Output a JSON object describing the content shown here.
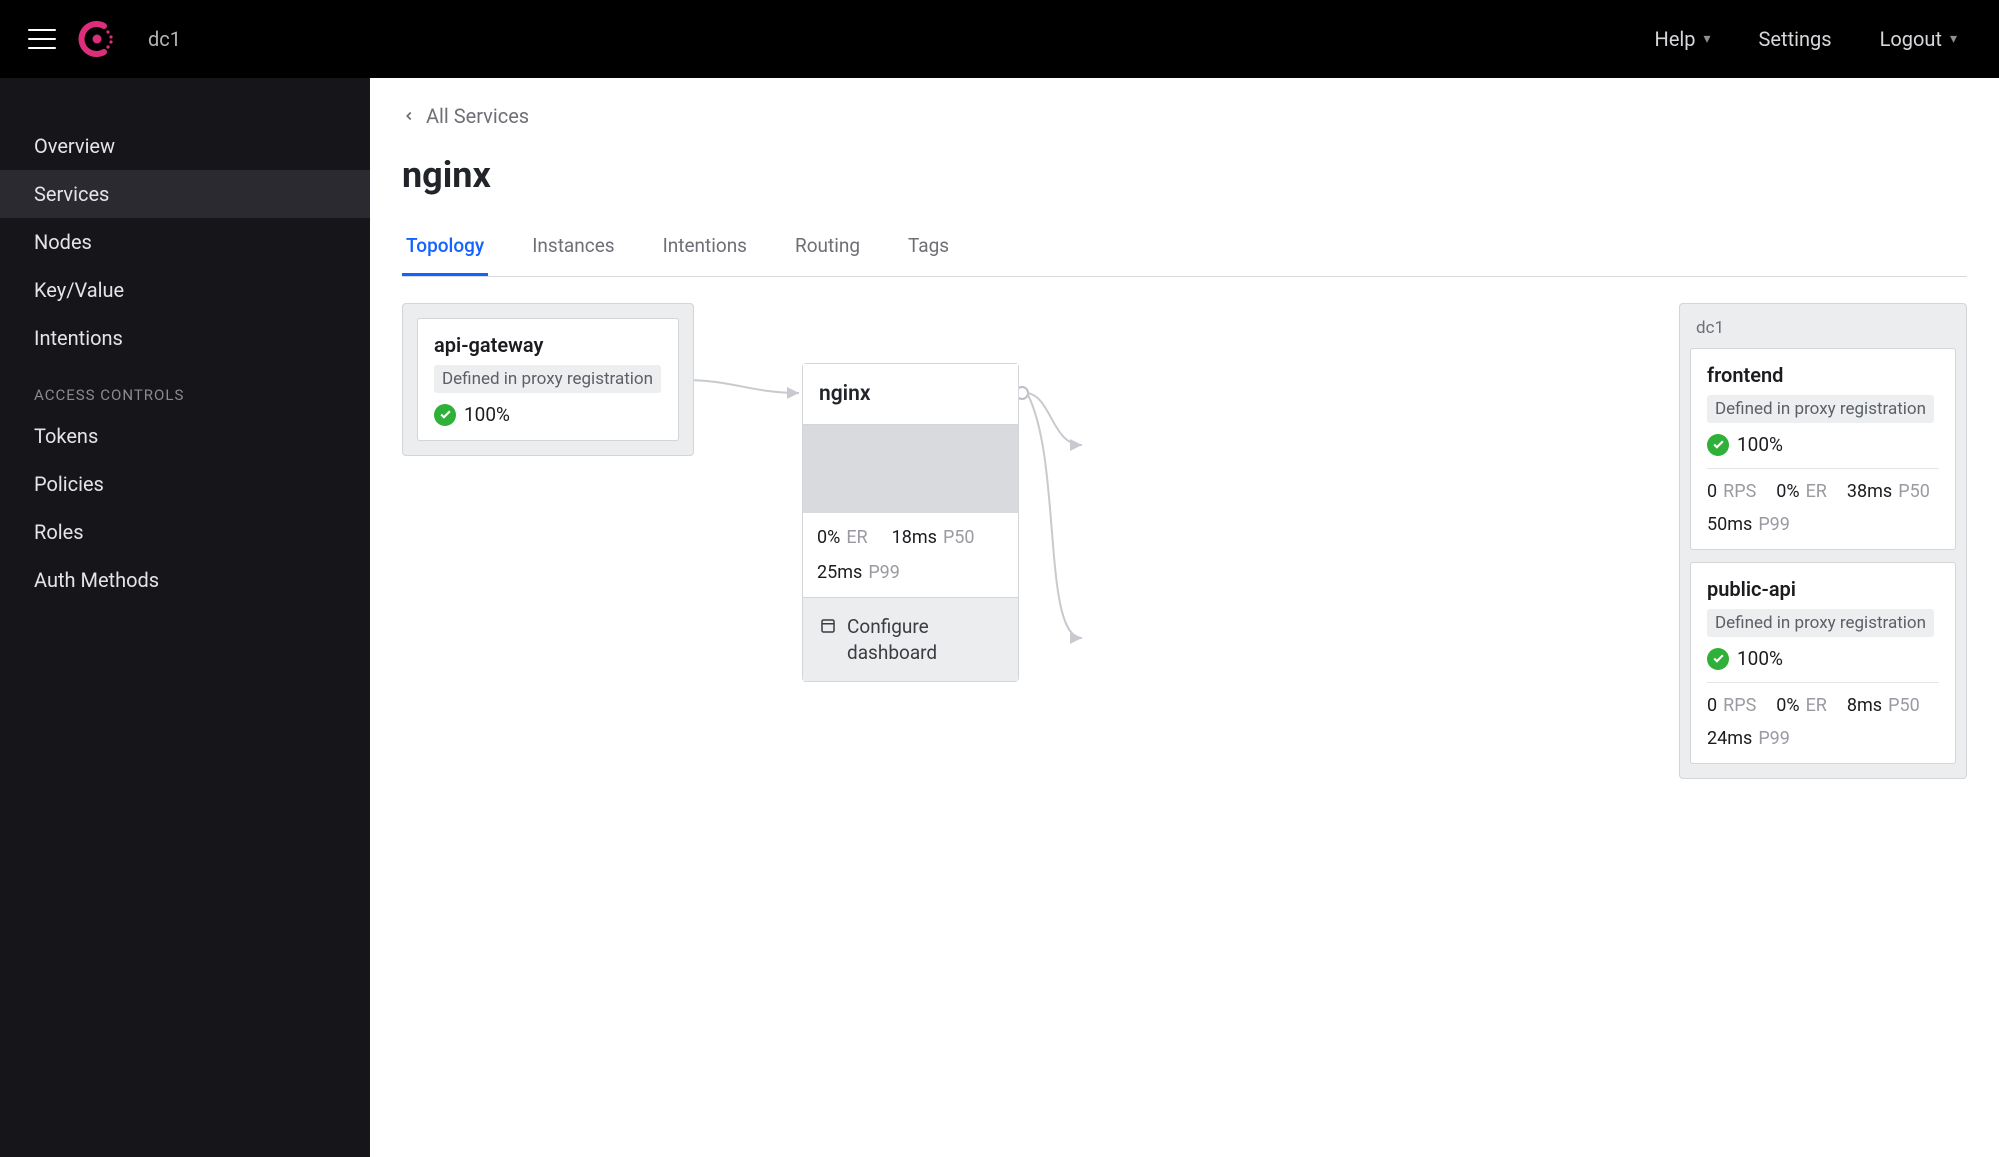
{
  "header": {
    "datacenter": "dc1",
    "help": "Help",
    "settings": "Settings",
    "logout": "Logout"
  },
  "sidebar": {
    "items": [
      "Overview",
      "Services",
      "Nodes",
      "Key/Value",
      "Intentions"
    ],
    "active_index": 1,
    "section_label": "ACCESS CONTROLS",
    "ac_items": [
      "Tokens",
      "Policies",
      "Roles",
      "Auth Methods"
    ]
  },
  "breadcrumb": {
    "back": "All Services"
  },
  "page": {
    "title": "nginx"
  },
  "tabs": {
    "items": [
      "Topology",
      "Instances",
      "Intentions",
      "Routing",
      "Tags"
    ],
    "active_index": 0
  },
  "topology": {
    "upstream": {
      "name": "api-gateway",
      "pill": "Defined in proxy registration",
      "health_pct": "100%"
    },
    "center": {
      "name": "nginx",
      "metrics": {
        "er_val": "0%",
        "er_label": "ER",
        "p50_val": "18ms",
        "p50_label": "P50",
        "p99_val": "25ms",
        "p99_label": "P99"
      },
      "footer": "Configure dashboard"
    },
    "downstream_dc": "dc1",
    "downstreams": [
      {
        "name": "frontend",
        "pill": "Defined in proxy registration",
        "health_pct": "100%",
        "metrics": {
          "rps_val": "0",
          "rps_label": "RPS",
          "er_val": "0%",
          "er_label": "ER",
          "p50_val": "38ms",
          "p50_label": "P50",
          "p99_val": "50ms",
          "p99_label": "P99"
        }
      },
      {
        "name": "public-api",
        "pill": "Defined in proxy registration",
        "health_pct": "100%",
        "metrics": {
          "rps_val": "0",
          "rps_label": "RPS",
          "er_val": "0%",
          "er_label": "ER",
          "p50_val": "8ms",
          "p50_label": "P50",
          "p99_val": "24ms",
          "p99_label": "P99"
        }
      }
    ]
  }
}
